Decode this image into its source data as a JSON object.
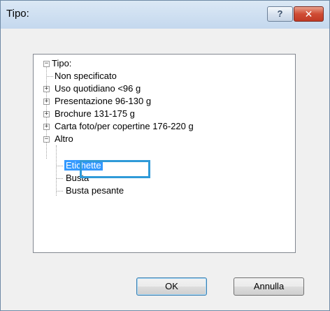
{
  "window": {
    "title": "Tipo:"
  },
  "titlebar": {
    "help_label": "?",
    "close_label": "✕"
  },
  "tree": {
    "root": {
      "label": "Tipo:",
      "toggle": "−"
    },
    "items": [
      {
        "label": "Non specificato",
        "toggle": ""
      },
      {
        "label": "Uso quotidiano <96 g",
        "toggle": "+"
      },
      {
        "label": "Presentazione 96-130 g",
        "toggle": "+"
      },
      {
        "label": "Brochure 131-175 g",
        "toggle": "+"
      },
      {
        "label": "Carta foto/per copertine 176-220 g",
        "toggle": "+"
      },
      {
        "label": "Altro",
        "toggle": "−"
      }
    ],
    "altro_children": [
      {
        "label": "Etichette",
        "selected": true
      },
      {
        "label": "Busta"
      },
      {
        "label": "Busta pesante"
      }
    ]
  },
  "buttons": {
    "ok": "OK",
    "cancel": "Annulla"
  },
  "colors": {
    "selection": "#3399ff",
    "highlight_box": "#2f9ad8",
    "close": "#c13a25"
  }
}
